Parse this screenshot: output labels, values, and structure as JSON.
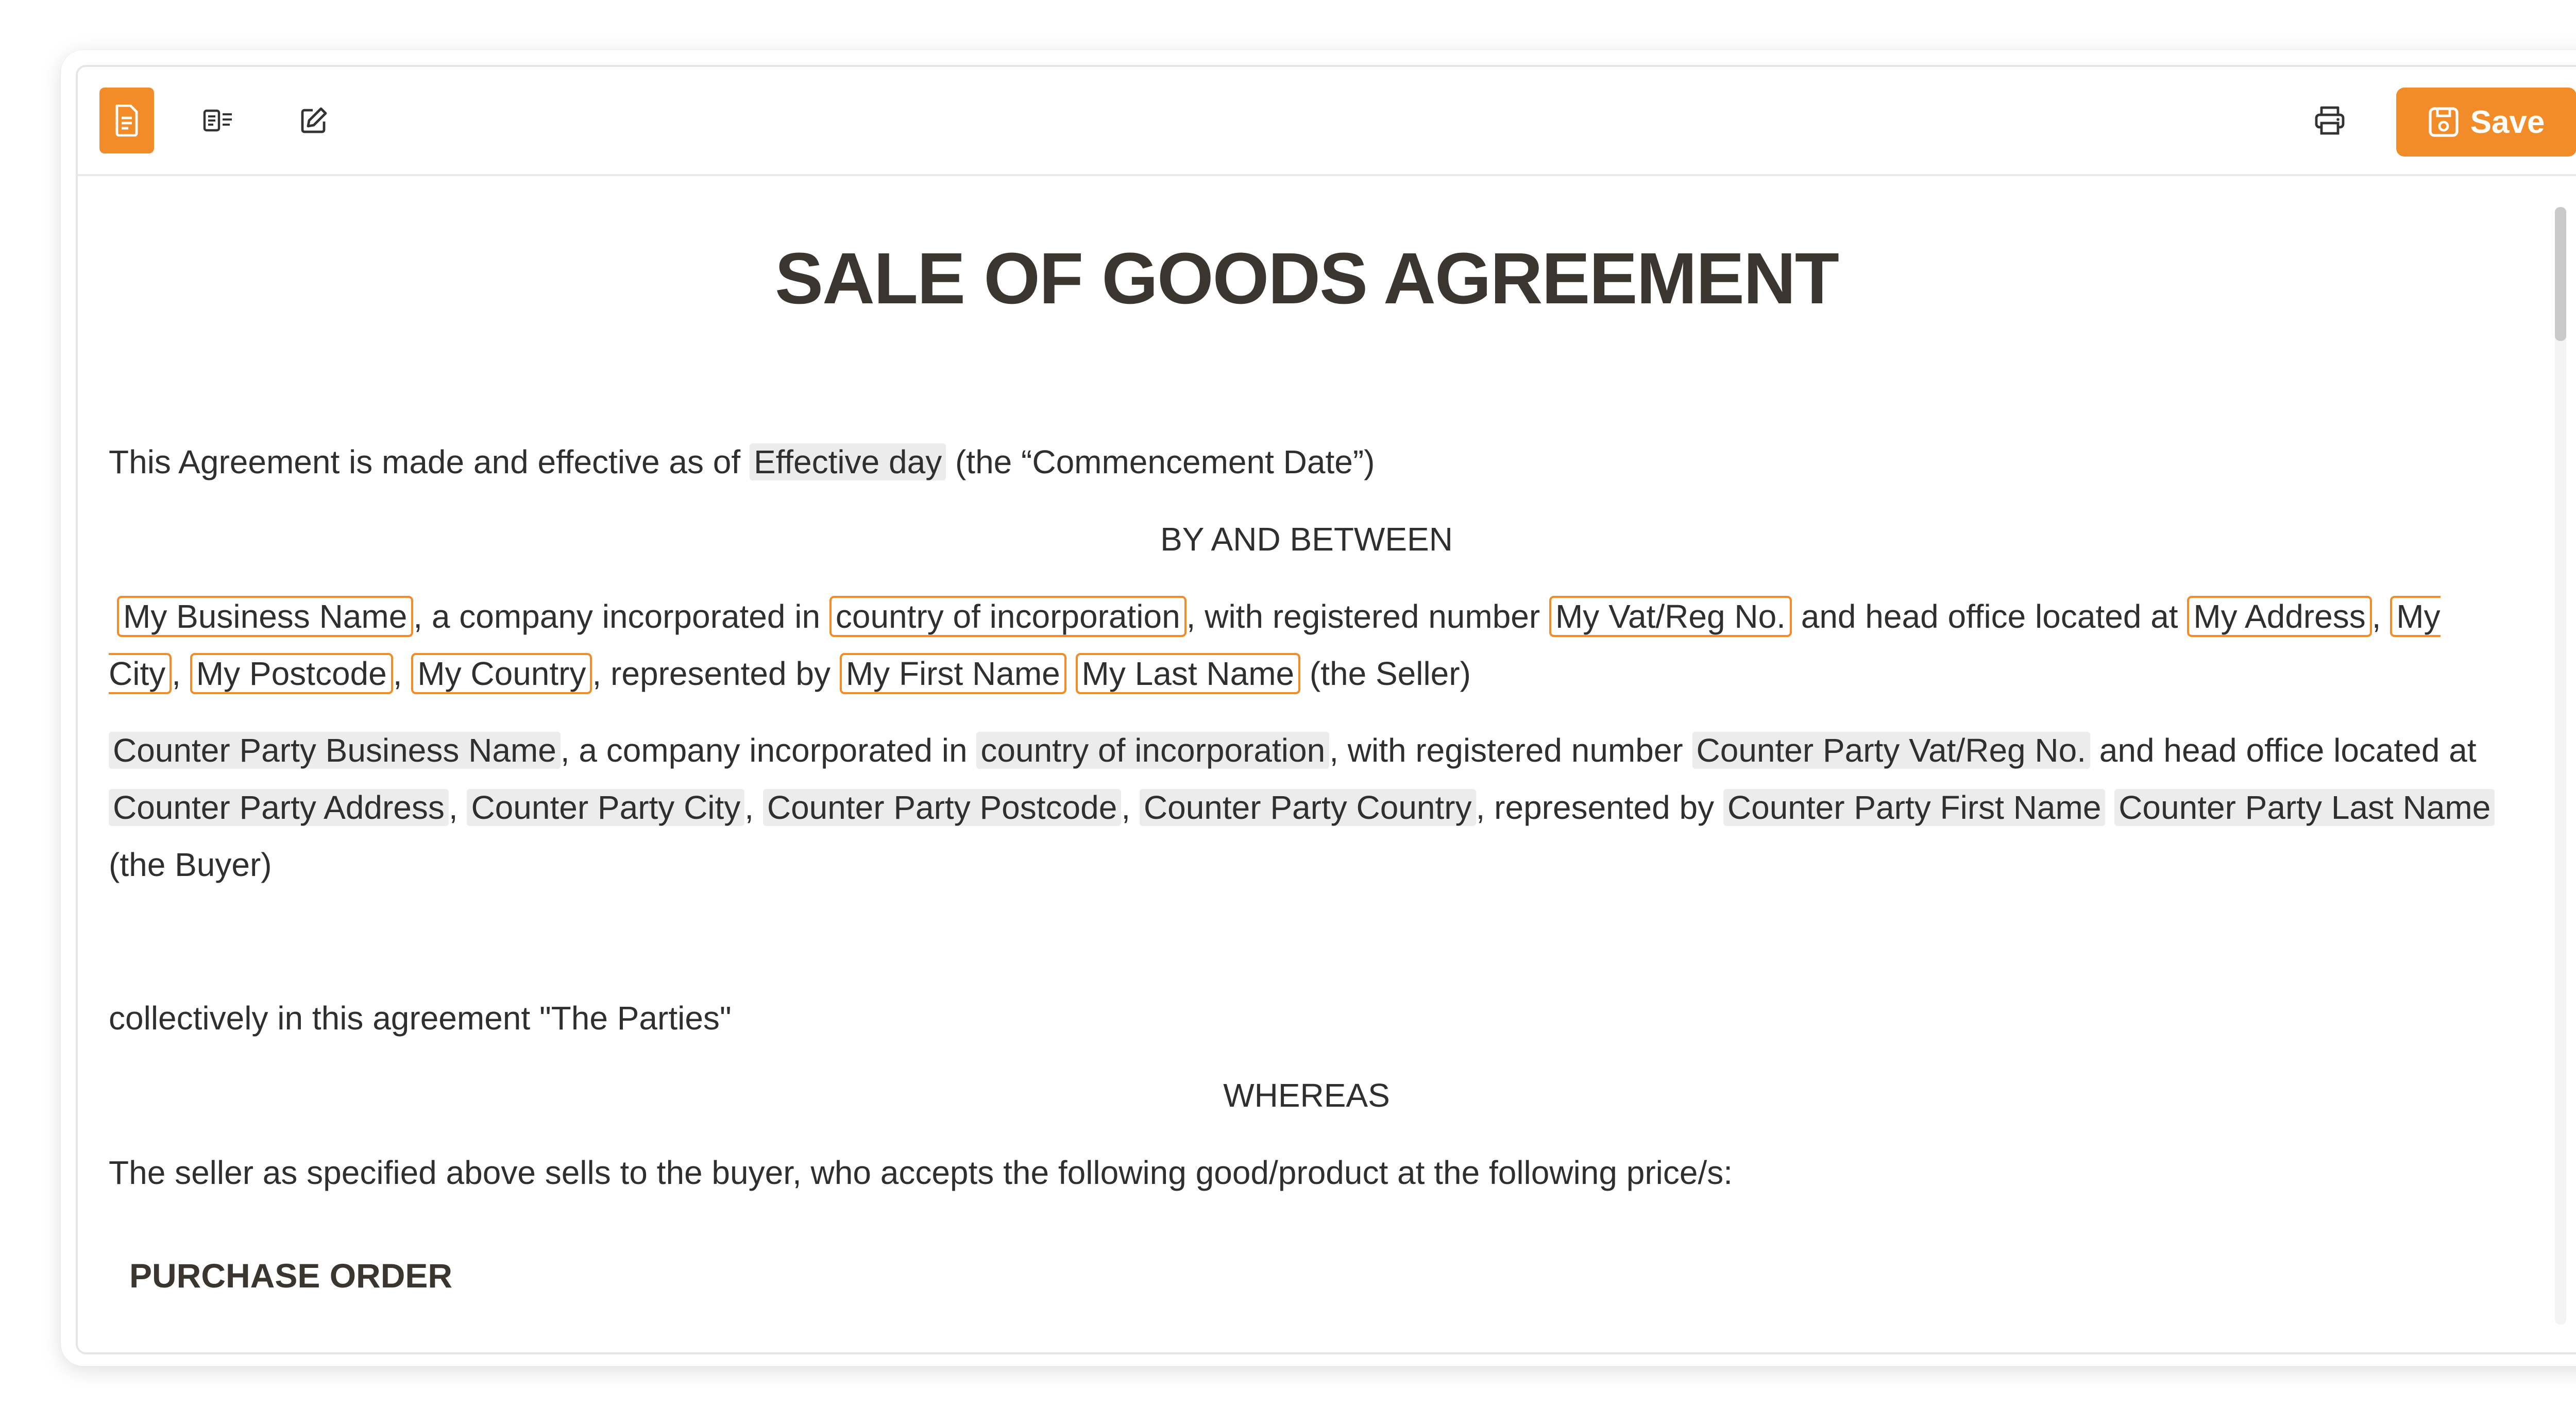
{
  "toolbar": {
    "icons": [
      "document-icon",
      "preview-icon",
      "edit-icon",
      "print-icon",
      "save-icon"
    ],
    "save_label": "Save",
    "accent": "#f28c28"
  },
  "document": {
    "title": "SALE OF GOODS AGREEMENT",
    "intro": {
      "prefix": "This  Agreement is made and effective as of ",
      "field": "Effective day",
      "suffix": " (the “Commencement Date”)"
    },
    "between": "BY AND BETWEEN",
    "seller": {
      "business_name": "My Business Name",
      "t1": ", a company incorporated in ",
      "country": "country of incorporation",
      "t2": ", with registered number ",
      "vat": "My Vat/Reg No.",
      "t3": "  and head office located at ",
      "address": "My Address",
      "comma": ", ",
      "city": "My City",
      "postcode": "My Postcode",
      "country_name": "My Country",
      "t4": ", represented by ",
      "first_name": "My First Name",
      "last_name": "My Last Name",
      "t5": " (the Seller)"
    },
    "buyer": {
      "business_name": "Counter Party Business Name",
      "t1": ", a company incorporated in ",
      "country": "country of incorporation",
      "t2": ", with registered number ",
      "vat": "Counter Party Vat/Reg No.",
      "t3": " and head office located at ",
      "address": "Counter Party Address",
      "comma": ", ",
      "city": "Counter Party City",
      "postcode": "Counter Party Postcode",
      "country_name": "Counter Party Country",
      "t4": ", represented by ",
      "first_name": "Counter Party First Name",
      "last_name": "Counter Party Last Name",
      "t5": "  (the Buyer)"
    },
    "collectively": "collectively in this agreement \"The Parties\"",
    "whereas": "WHEREAS",
    "seller_statement": "The seller as specified above sells to the buyer, who accepts the following good/product at the following price/s:",
    "purchase_order": "PURCHASE ORDER"
  }
}
